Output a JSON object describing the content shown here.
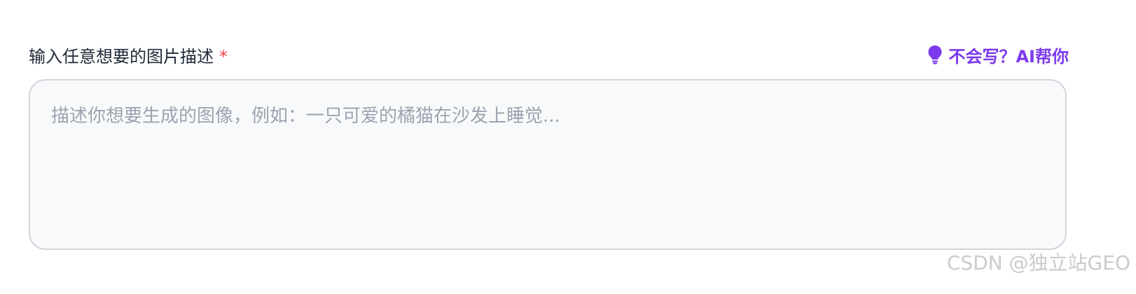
{
  "field": {
    "label": "输入任意想要的图片描述",
    "required_marker": "*",
    "placeholder": "描述你想要生成的图像，例如：一只可爱的橘猫在沙发上睡觉...",
    "value": ""
  },
  "ai_help": {
    "icon": "lightbulb-icon",
    "label": "不会写？AI帮你"
  },
  "watermark": {
    "text": "CSDN @独立站GEO"
  },
  "colors": {
    "accent": "#7c3aed",
    "required": "#ef4444",
    "input_bg": "#f8f9fb",
    "input_border": "#d1d5db",
    "placeholder": "#9ca3af"
  }
}
